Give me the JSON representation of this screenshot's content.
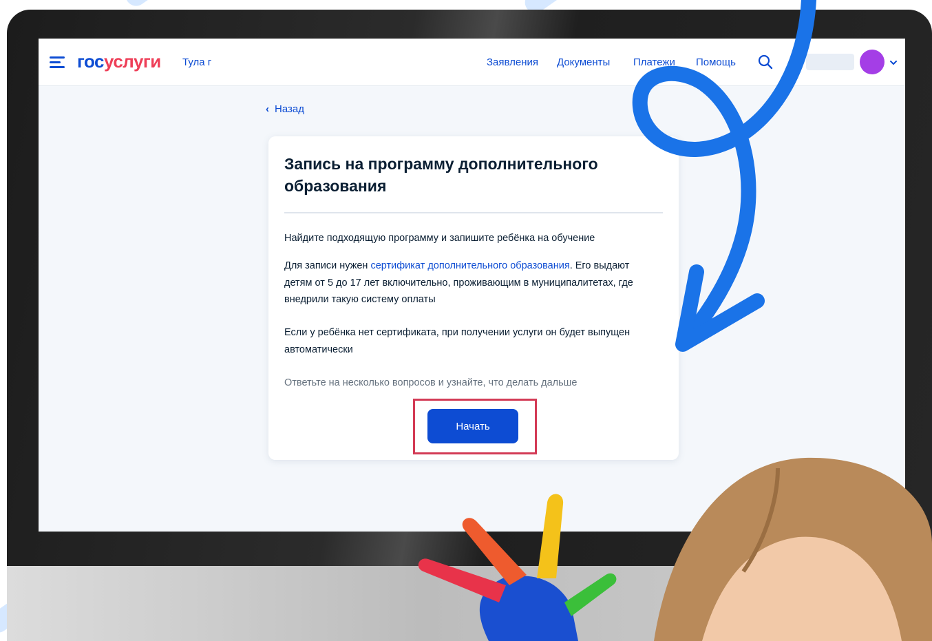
{
  "colors": {
    "primary_blue": "#0d4cd3",
    "logo_red": "#ee3f58",
    "text_dark": "#0b1f33",
    "text_muted": "#66727f",
    "highlight_red": "#d33a55",
    "avatar_purple": "#a43ee6",
    "overlay_arrow_blue": "#1a73e8"
  },
  "header": {
    "logo_part1": "гос",
    "logo_part2": "услуги",
    "city": "Тула г",
    "nav": [
      {
        "label": "Заявления"
      },
      {
        "label": "Документы"
      },
      {
        "label": "Платежи"
      },
      {
        "label": "Помощь"
      }
    ],
    "icons": {
      "menu": "hamburger-menu-icon",
      "search": "search-icon",
      "chevron": "chevron-down-icon"
    }
  },
  "back_link": {
    "label": "Назад"
  },
  "card": {
    "title": "Запись на программу дополнительного образования",
    "intro": "Найдите подходящую программу и запишите ребёнка на обучение",
    "requirement_prefix": "Для записи нужен ",
    "requirement_link": "сертификат дополнительного образования",
    "requirement_suffix": ". Его выдают детям от 5 до 17 лет включительно, проживающим в муниципалитетах, где внедрили такую систему оплаты",
    "no_certificate": "Если у ребёнка нет сертификата, при получении услуги он будет выпущен автоматически",
    "hint": "Ответьте на несколько вопросов и узнайте, что делать дальше",
    "start_button": "Начать"
  }
}
